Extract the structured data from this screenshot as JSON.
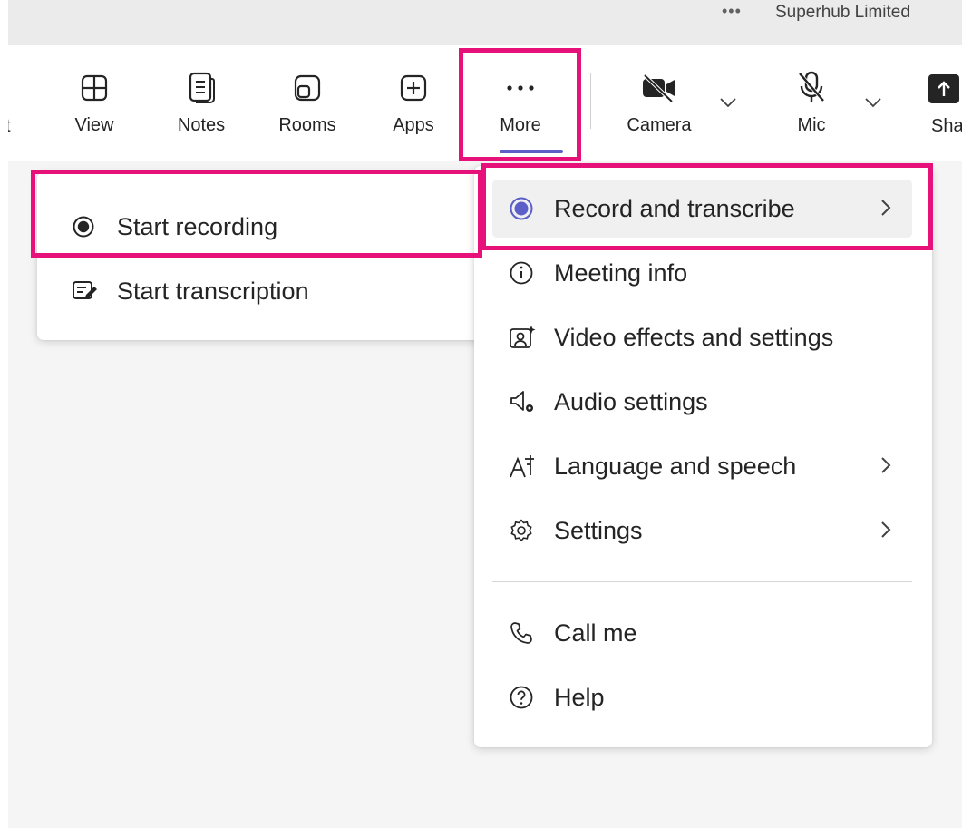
{
  "header": {
    "overflow_icon": "more-horizontal-icon",
    "org_name": "Superhub Limited"
  },
  "toolbar": {
    "clipped_left_label": "t",
    "buttons": [
      {
        "id": "view",
        "label": "View",
        "icon": "grid-layout-icon"
      },
      {
        "id": "notes",
        "label": "Notes",
        "icon": "notes-icon"
      },
      {
        "id": "rooms",
        "label": "Rooms",
        "icon": "rooms-icon"
      },
      {
        "id": "apps",
        "label": "Apps",
        "icon": "add-app-icon"
      },
      {
        "id": "more",
        "label": "More",
        "icon": "more-horizontal-icon",
        "selected": true
      },
      {
        "id": "camera",
        "label": "Camera",
        "icon": "camera-off-icon"
      },
      {
        "id": "mic",
        "label": "Mic",
        "icon": "mic-off-icon"
      },
      {
        "id": "share",
        "label": "Share",
        "icon": "share-icon"
      }
    ]
  },
  "more_menu": {
    "items": [
      {
        "label": "Record and transcribe",
        "icon": "record-icon",
        "has_submenu": true,
        "active": true
      },
      {
        "label": "Meeting info",
        "icon": "info-icon",
        "has_submenu": false
      },
      {
        "label": "Video effects and settings",
        "icon": "video-effects-icon",
        "has_submenu": false
      },
      {
        "label": "Audio settings",
        "icon": "audio-settings-icon",
        "has_submenu": false
      },
      {
        "label": "Language and speech",
        "icon": "language-icon",
        "has_submenu": true
      },
      {
        "label": "Settings",
        "icon": "gear-icon",
        "has_submenu": true
      },
      {
        "label": "Call me",
        "icon": "phone-icon",
        "has_submenu": false
      },
      {
        "label": "Help",
        "icon": "help-icon",
        "has_submenu": false
      }
    ]
  },
  "record_submenu": {
    "items": [
      {
        "label": "Start recording",
        "icon": "record-dot-icon"
      },
      {
        "label": "Start transcription",
        "icon": "transcript-icon"
      }
    ]
  },
  "colors": {
    "highlight": "#e6127a",
    "accent": "#5b5fc7",
    "text": "#242424",
    "background": "#f5f5f5"
  }
}
